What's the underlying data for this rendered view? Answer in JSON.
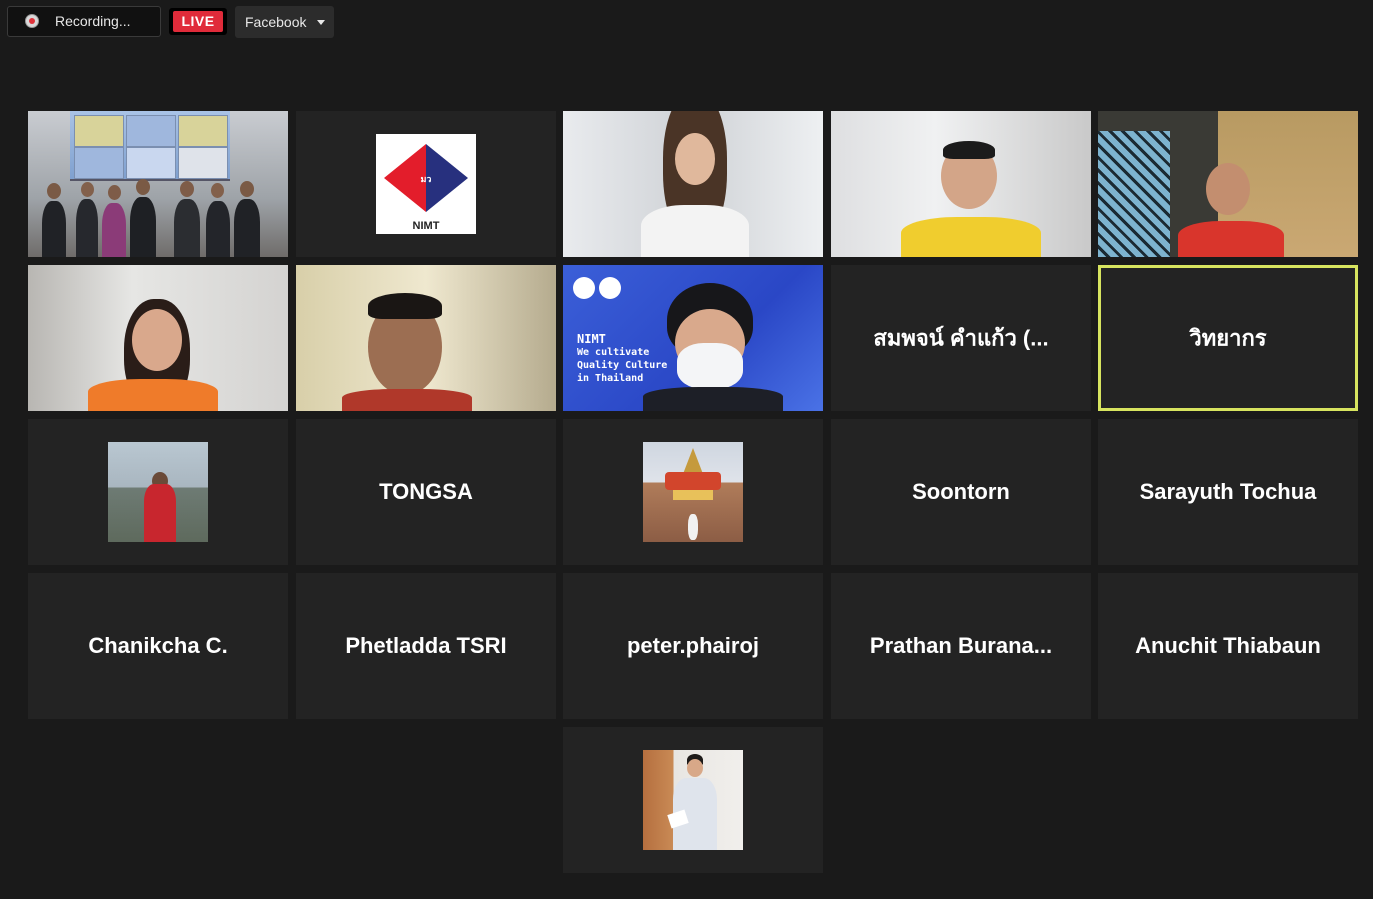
{
  "toolbar": {
    "recording_label": "Recording...",
    "live_label": "LIVE",
    "stream_target": "Facebook"
  },
  "colors": {
    "background": "#1a1a1a",
    "tile": "#232323",
    "live_red": "#e02b3a",
    "active_speaker_border": "#d7e45f"
  },
  "participants": {
    "r2c4": "สมพจน์ คำแก้ว (...",
    "r2c5": "วิทยากร",
    "r3c2": "TONGSA",
    "r3c4": "Soontorn",
    "r3c5": "Sarayuth Tochua",
    "r4c1": "Chanikcha C.",
    "r4c2": "Phetladda TSRI",
    "r4c3": "peter.phairoj",
    "r4c4": "Prathan  Burana...",
    "r4c5": "Anuchit Thiabaun"
  },
  "logo": {
    "text": "NIMT",
    "mark": "มว"
  },
  "banner": {
    "title": "NIMT",
    "line1": "We cultivate",
    "line2": "Quality Culture",
    "line3": "in Thailand"
  }
}
